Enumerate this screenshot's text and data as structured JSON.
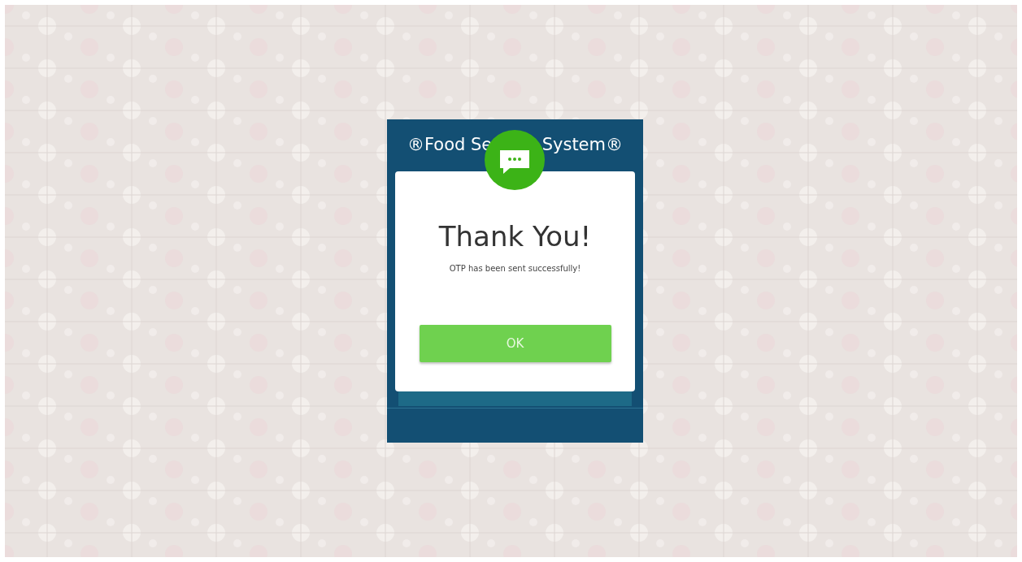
{
  "header": {
    "title_left": "®Food Se",
    "title_right": "System®"
  },
  "dialog": {
    "title": "Thank You!",
    "message": "OTP has been sent successfully!",
    "button": "OK"
  }
}
